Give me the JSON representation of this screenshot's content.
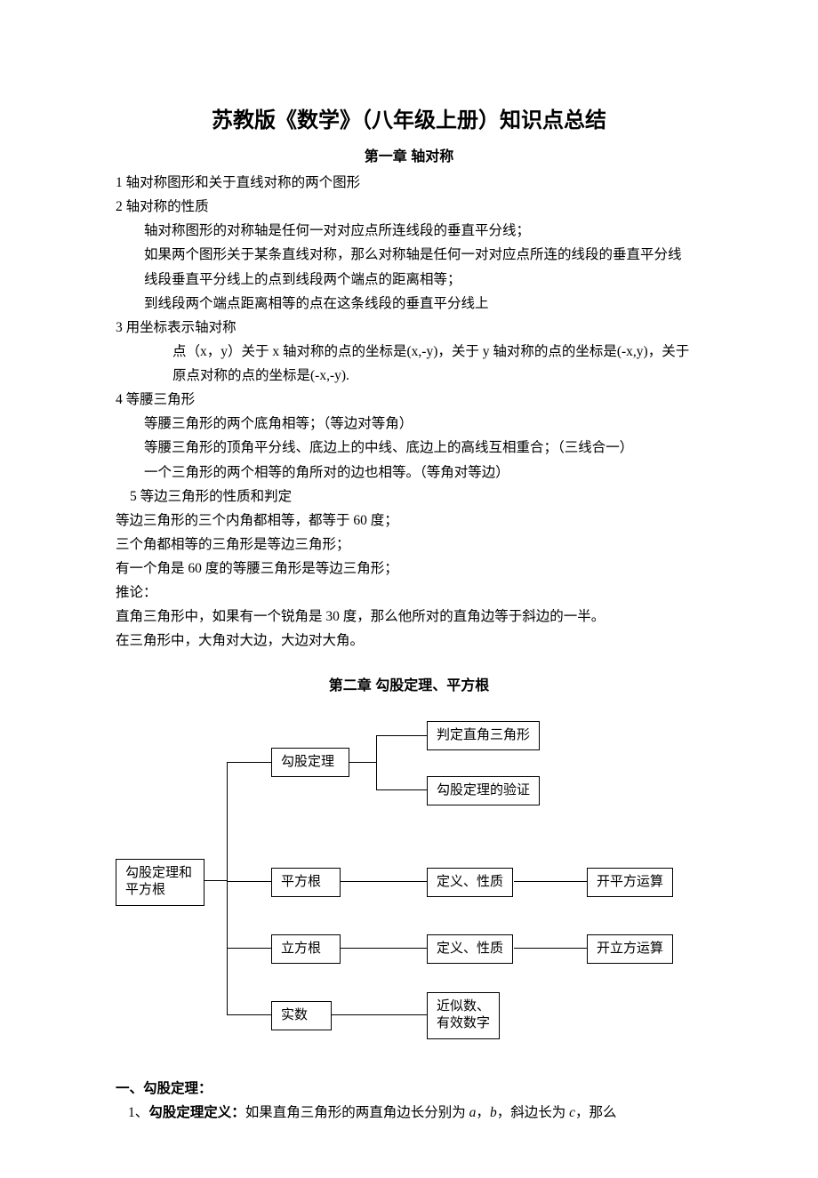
{
  "title": "苏教版《数学》（八年级上册）知识点总结",
  "chapter1": {
    "heading": "第一章  轴对称",
    "l1": "1 轴对称图形和关于直线对称的两个图形",
    "l2": "2 轴对称的性质",
    "l2a": "轴对称图形的对称轴是任何一对对应点所连线段的垂直平分线；",
    "l2b": "如果两个图形关于某条直线对称，那么对称轴是任何一对对应点所连的线段的垂直平分线",
    "l2c": "线段垂直平分线上的点到线段两个端点的距离相等；",
    "l2d": "到线段两个端点距离相等的点在这条线段的垂直平分线上",
    "l3": "3 用坐标表示轴对称",
    "l3a": "点（x，y）关于 x 轴对称的点的坐标是(x,-y)，关于 y 轴对称的点的坐标是(-x,y)，关于原点对称的点的坐标是(-x,-y).",
    "l4": "4 等腰三角形",
    "l4a": "等腰三角形的两个底角相等；（等边对等角）",
    "l4b": "等腰三角形的顶角平分线、底边上的中线、底边上的高线互相重合；（三线合一）",
    "l4c": "一个三角形的两个相等的角所对的边也相等。（等角对等边）",
    "l5": "5  等边三角形的性质和判定",
    "l5a": "等边三角形的三个内角都相等，都等于 60 度；",
    "l5b": "三个角都相等的三角形是等边三角形；",
    "l5c": "有一个角是 60 度的等腰三角形是等边三角形；",
    "l5d": " 推论：",
    "l5e": "直角三角形中，如果有一个锐角是 30 度，那么他所对的直角边等于斜边的一半。",
    "l5f": "在三角形中，大角对大边，大边对大角。"
  },
  "chapter2": {
    "heading": "第二章 勾股定理、平方根",
    "n_root": "勾股定理和平方根",
    "n_gougu": "勾股定理",
    "n_pingfg": "平方根",
    "n_lifg": "立方根",
    "n_shishu": "实数",
    "n_panding": "判定直角三角形",
    "n_yanzheng": "勾股定理的验证",
    "n_dyxz1": "定义、性质",
    "n_dyxz2": "定义、性质",
    "n_kaipf": "开平方运算",
    "n_kailf": "开立方运算",
    "n_jinshi": "近似数、\n有效数字",
    "s1": "一、勾股定理：",
    "s1_1a": "1、",
    "s1_1b": "勾股定理定义：",
    "s1_1c": "如果直角三角形的两直角边长分别为 ",
    "s1_a": "a",
    "s1_comma1": "，",
    "s1_b": "b",
    "s1_mid": "，斜边长为 ",
    "s1_c": "c",
    "s1_end": "，那么"
  }
}
